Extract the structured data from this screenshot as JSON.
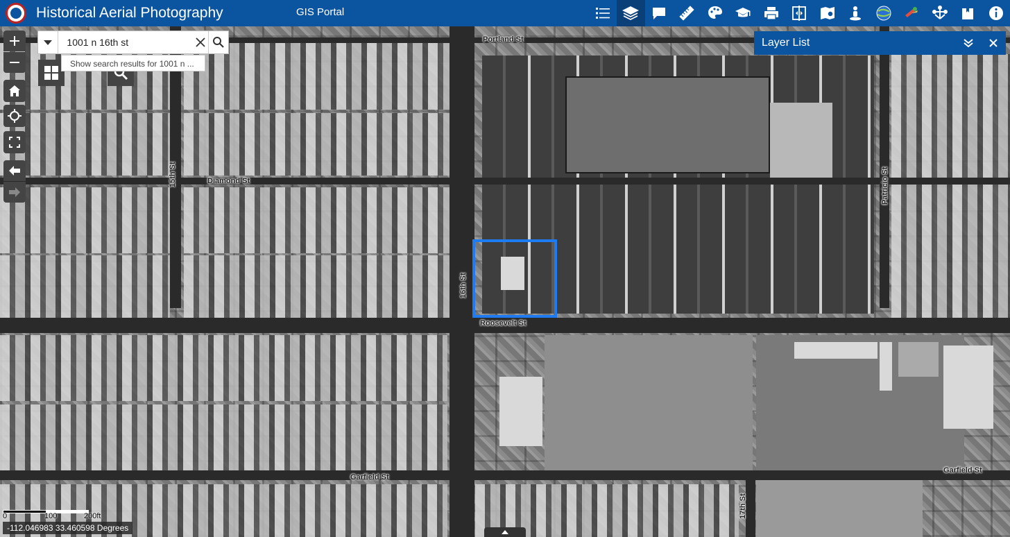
{
  "header": {
    "title": "Historical Aerial Photography",
    "subtitle": "GIS Portal",
    "logo_icon": "city-seal-logo",
    "tools": [
      {
        "name": "legend-icon",
        "active": false
      },
      {
        "name": "layers-icon",
        "active": true
      },
      {
        "name": "comment-icon",
        "active": false
      },
      {
        "name": "measure-ruler-icon",
        "active": false
      },
      {
        "name": "palette-icon",
        "active": false
      },
      {
        "name": "education-icon",
        "active": false
      },
      {
        "name": "print-icon",
        "active": false
      },
      {
        "name": "swipe-compare-icon",
        "active": false
      },
      {
        "name": "map-book-icon",
        "active": false
      },
      {
        "name": "street-view-icon",
        "active": false
      },
      {
        "name": "globe-icon",
        "active": false
      },
      {
        "name": "satellite-icon",
        "active": false
      },
      {
        "name": "network-icon",
        "active": false
      },
      {
        "name": "bookmark-icon",
        "active": false
      },
      {
        "name": "info-icon",
        "active": false
      }
    ]
  },
  "search": {
    "value": "1001 n 16th st",
    "suggestion": "Show search results for 1001 n ..."
  },
  "layer_panel": {
    "title": "Layer List"
  },
  "map_labels": {
    "portland": "Portland St",
    "diamond": "Diamond St",
    "roosevelt": "Roosevelt St",
    "garfield_left": "Garfield St",
    "garfield_right": "Garfield St",
    "fifteenth": "15th St",
    "sixteenth": "16th St",
    "seventeenth": "17th St",
    "patricio": "Patricio St"
  },
  "scale": {
    "zero": "0",
    "mid": "100",
    "end": "200ft"
  },
  "coordinates": "-112.046983 33.460598 Degrees",
  "colors": {
    "header": "#0b55a0",
    "highlight": "#1e7bf2"
  }
}
